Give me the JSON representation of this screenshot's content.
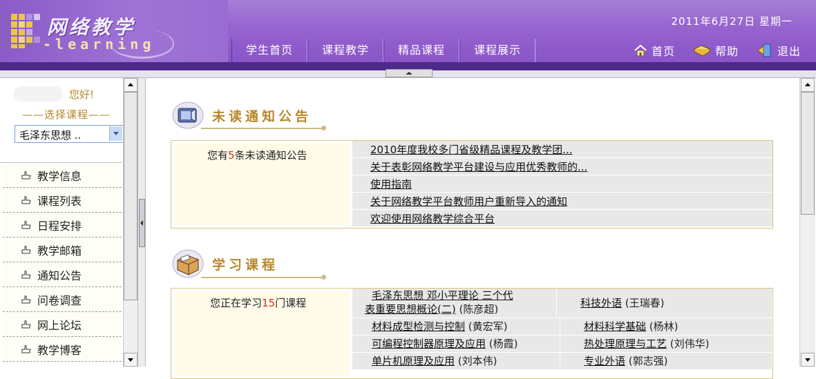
{
  "header": {
    "logo_title": "网络教学",
    "logo_sub": "-learning",
    "date": "2011年6月27日  星期一",
    "nav_tabs": [
      "学生首页",
      "课程教学",
      "精品课程",
      "课程展示"
    ],
    "util_links": [
      {
        "label": "首页",
        "icon": "home-icon"
      },
      {
        "label": "帮助",
        "icon": "help-book-icon"
      },
      {
        "label": "退出",
        "icon": "exit-icon"
      }
    ]
  },
  "sidebar": {
    "greeting": "您好!",
    "choose_label": "——选择课程——",
    "course_select_value": "毛泽东思想 ..",
    "menu": [
      "教学信息",
      "课程列表",
      "日程安排",
      "教学邮箱",
      "通知公告",
      "问卷调查",
      "网上论坛",
      "教学博客"
    ]
  },
  "notices": {
    "title": "未读通知公告",
    "summary_prefix": "您有",
    "count": "5",
    "summary_suffix": "条未读通知公告",
    "items": [
      "2010年度我校多门省级精品课程及教学团...",
      "关于表彰网络教学平台建设与应用优秀教师的...",
      "使用指南",
      "关于网络教学平台教师用户重新导入的通知",
      "欢迎使用网络教学综合平台"
    ]
  },
  "courses": {
    "title": "学习课程",
    "summary_prefix": "您正在学习",
    "count": "15",
    "summary_suffix": "门课程",
    "rows": [
      [
        {
          "name_line1": "毛泽东思想 邓小平理论 三个代",
          "name_line2": "表重要思想概论(二)",
          "teacher": "(陈彦超)"
        },
        {
          "name_line1": "科技外语",
          "name_line2": "",
          "teacher": "(王瑞春)"
        }
      ],
      [
        {
          "name_line1": "材料成型检测与控制",
          "name_line2": "",
          "teacher": "(黄宏军)"
        },
        {
          "name_line1": "材料科学基础",
          "name_line2": "",
          "teacher": "(杨林)"
        }
      ],
      [
        {
          "name_line1": "可编程控制器原理及应用",
          "name_line2": "",
          "teacher": "(杨霞)"
        },
        {
          "name_line1": "热处理原理与工艺",
          "name_line2": "",
          "teacher": "(刘伟华)"
        }
      ],
      [
        {
          "name_line1": "单片机原理及应用",
          "name_line2": "",
          "teacher": "(刘本伟)"
        },
        {
          "name_line1": "专业外语",
          "name_line2": "",
          "teacher": "(郭志强)"
        }
      ]
    ]
  }
}
